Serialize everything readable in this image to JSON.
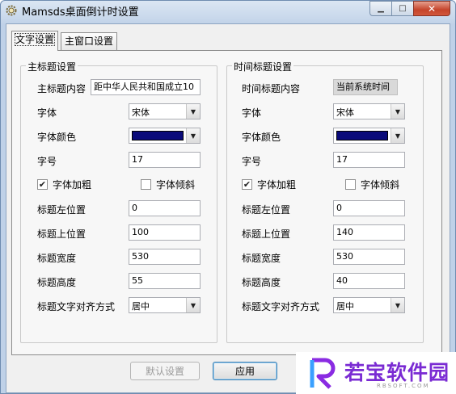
{
  "window": {
    "title": "Mamsds桌面倒计时设置"
  },
  "tabs": [
    {
      "label": "文字设置"
    },
    {
      "label": "主窗口设置"
    }
  ],
  "main_group": {
    "title": "主标题设置",
    "content_label": "主标题内容",
    "content_value": "距中华人民共和国成立10",
    "font_label": "字体",
    "font_value": "宋体",
    "color_label": "字体颜色",
    "color_value": "#0a0a7a",
    "size_label": "字号",
    "size_value": "17",
    "bold_label": "字体加粗",
    "bold_checked": "✔",
    "italic_label": "字体倾斜",
    "left_label": "标题左位置",
    "left_value": "0",
    "top_label": "标题上位置",
    "top_value": "100",
    "width_label": "标题宽度",
    "width_value": "530",
    "height_label": "标题高度",
    "height_value": "55",
    "align_label": "标题文字对齐方式",
    "align_value": "居中"
  },
  "time_group": {
    "title": "时间标题设置",
    "content_label": "时间标题内容",
    "content_value": "当前系统时间",
    "font_label": "字体",
    "font_value": "宋体",
    "color_label": "字体颜色",
    "color_value": "#0a0a7a",
    "size_label": "字号",
    "size_value": "17",
    "bold_label": "字体加粗",
    "bold_checked": "✔",
    "italic_label": "字体倾斜",
    "left_label": "标题左位置",
    "left_value": "0",
    "top_label": "标题上位置",
    "top_value": "140",
    "width_label": "标题宽度",
    "width_value": "530",
    "height_label": "标题高度",
    "height_value": "40",
    "align_label": "标题文字对齐方式",
    "align_value": "居中"
  },
  "buttons": {
    "default_settings": "默认设置",
    "apply": "应用"
  },
  "watermark": {
    "text": "若宝软件园",
    "sub": "RBSOFT.COM"
  }
}
